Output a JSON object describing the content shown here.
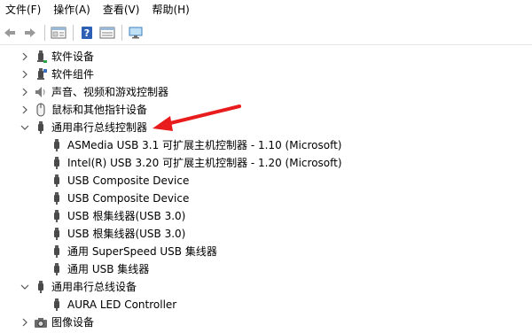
{
  "menu": {
    "file": "文件(F)",
    "action": "操作(A)",
    "view": "查看(V)",
    "help": "帮助(H)"
  },
  "toolbar": {
    "items": [
      "back-icon",
      "forward-icon",
      "properties-icon",
      "help-icon",
      "update-driver-icon",
      "monitor-icon"
    ]
  },
  "tree": {
    "software_devices": "软件设备",
    "software_components": "软件组件",
    "sound_video_game": "声音、视频和游戏控制器",
    "mice_pointing": "鼠标和其他指针设备",
    "usb_controllers": "通用串行总线控制器",
    "usb_children": [
      "ASMedia USB 3.1 可扩展主机控制器 - 1.10 (Microsoft)",
      "Intel(R) USB 3.20 可扩展主机控制器 - 1.20 (Microsoft)",
      "USB Composite Device",
      "USB Composite Device",
      "USB 根集线器(USB 3.0)",
      "USB 根集线器(USB 3.0)",
      "通用 SuperSpeed USB 集线器",
      "通用 USB 集线器"
    ],
    "usb_devices": "通用串行总线设备",
    "usb_devices_children": [
      "AURA LED Controller"
    ],
    "imaging_devices": "图像设备"
  },
  "colors": {
    "annotation_arrow": "#e81c1c",
    "chevron": "#555555",
    "usb_icon": "#5a5a5a"
  }
}
